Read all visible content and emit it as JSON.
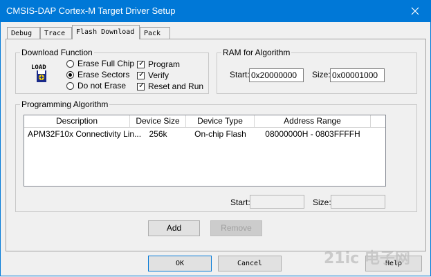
{
  "window": {
    "title": "CMSIS-DAP Cortex-M Target Driver Setup"
  },
  "tabs": [
    {
      "label": "Debug"
    },
    {
      "label": "Trace"
    },
    {
      "label": "Flash Download"
    },
    {
      "label": "Pack"
    }
  ],
  "download_function": {
    "title": "Download Function",
    "load_label": "LOAD",
    "radios": [
      {
        "label": "Erase Full Chip",
        "selected": false
      },
      {
        "label": "Erase Sectors",
        "selected": true
      },
      {
        "label": "Do not Erase",
        "selected": false
      }
    ],
    "checks": [
      {
        "label": "Program",
        "checked": true
      },
      {
        "label": "Verify",
        "checked": true
      },
      {
        "label": "Reset and Run",
        "checked": true
      }
    ]
  },
  "ram": {
    "title": "RAM for Algorithm",
    "start_label": "Start:",
    "start_value": "0x20000000",
    "size_label": "Size:",
    "size_value": "0x00001000"
  },
  "programming": {
    "title": "Programming Algorithm",
    "columns": [
      "Description",
      "Device Size",
      "Device Type",
      "Address Range"
    ],
    "rows": [
      [
        "APM32F10x Connectivity Lin...",
        "256k",
        "On-chip Flash",
        "08000000H - 0803FFFFH"
      ]
    ],
    "start_label": "Start:",
    "start_value": "",
    "size_label": "Size:",
    "size_value": ""
  },
  "actions": {
    "add_label": "Add",
    "remove_label": "Remove"
  },
  "footer": {
    "ok_label": "OK",
    "cancel_label": "Cancel",
    "help_label": "Help"
  },
  "watermark": "21ic 电子网",
  "colors": {
    "titlebar": "#0078d7",
    "panel": "#f0f0f0",
    "load_icon": "#1a2a8a"
  }
}
